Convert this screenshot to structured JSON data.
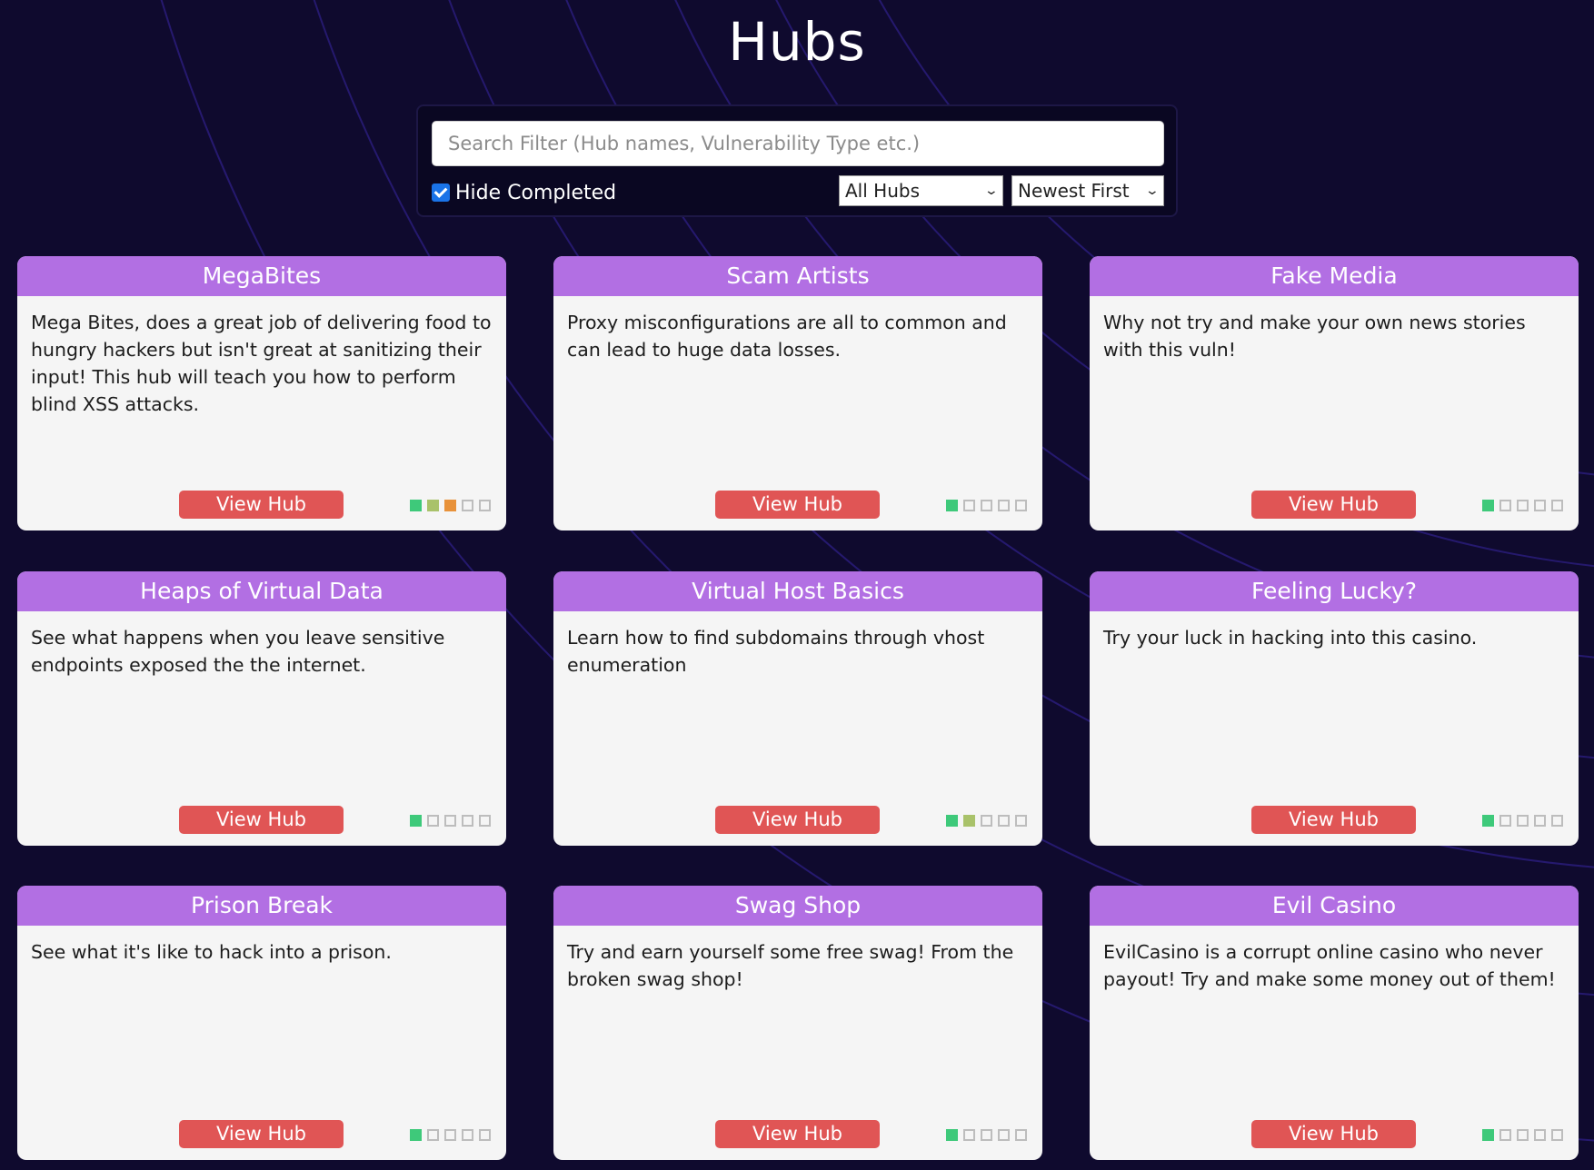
{
  "page_title": "Hubs",
  "filter": {
    "search_placeholder": "Search Filter (Hub names, Vulnerability Type etc.)",
    "hide_completed_label": "Hide Completed",
    "hide_completed_checked": true,
    "category_select": "All Hubs",
    "sort_select": "Newest First"
  },
  "colors": {
    "background": "#0f0a2e",
    "card_header": "#b26fe3",
    "button": "#e05555",
    "difficulty_1": "#3ec97a",
    "difficulty_2": "#a9c26a",
    "difficulty_3": "#e8923a"
  },
  "hubs": [
    {
      "title": "MegaBites",
      "description": "Mega Bites, does a great job of delivering food to hungry hackers but isn't great at sanitizing their input! This hub will teach you how to perform blind XSS attacks.",
      "button": "View Hub",
      "difficulty": 3
    },
    {
      "title": "Scam Artists",
      "description": "Proxy misconfigurations are all to common and can lead to huge data losses.",
      "button": "View Hub",
      "difficulty": 1
    },
    {
      "title": "Fake Media",
      "description": "Why not try and make your own news stories with this vuln!",
      "button": "View Hub",
      "difficulty": 1
    },
    {
      "title": "Heaps of Virtual Data",
      "description": "See what happens when you leave sensitive endpoints exposed the the internet.",
      "button": "View Hub",
      "difficulty": 1
    },
    {
      "title": "Virtual Host Basics",
      "description": "Learn how to find subdomains through vhost enumeration",
      "button": "View Hub",
      "difficulty": 2
    },
    {
      "title": "Feeling Lucky?",
      "description": "Try your luck in hacking into this casino.",
      "button": "View Hub",
      "difficulty": 1
    },
    {
      "title": "Prison Break",
      "description": "See what it's like to hack into a prison.",
      "button": "View Hub",
      "difficulty": 1
    },
    {
      "title": "Swag Shop",
      "description": "Try and earn yourself some free swag! From the broken swag shop!",
      "button": "View Hub",
      "difficulty": 1
    },
    {
      "title": "Evil Casino",
      "description": "EvilCasino is a corrupt online casino who never payout! Try and make some money out of them!",
      "button": "View Hub",
      "difficulty": 1
    }
  ]
}
